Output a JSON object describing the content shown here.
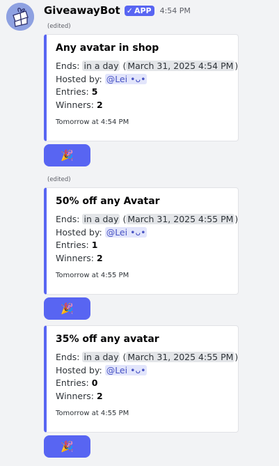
{
  "bot": {
    "name": "GiveawayBot",
    "badge": "APP",
    "badge_check": "✓",
    "time": "4:54 PM",
    "avatar_icon": "giveaway-bot-avatar-icon"
  },
  "messages": [
    {
      "edited": "(edited)",
      "title": "Any avatar in shop",
      "ends_label": "Ends:",
      "ends_relative": "in a day",
      "ends_absolute": "March 31, 2025 4:54 PM",
      "hosted_label": "Hosted by:",
      "host": "@Lei •ᴗ•",
      "entries_label": "Entries:",
      "entries": "5",
      "winners_label": "Winners:",
      "winners": "2",
      "footer": "Tomorrow at 4:54 PM",
      "button_emoji": "🎉"
    },
    {
      "edited": "(edited)",
      "title": "50% off any Avatar",
      "ends_label": "Ends:",
      "ends_relative": "in a day",
      "ends_absolute": "March 31, 2025 4:55 PM",
      "hosted_label": "Hosted by:",
      "host": "@Lei •ᴗ•",
      "entries_label": "Entries:",
      "entries": "1",
      "winners_label": "Winners:",
      "winners": "2",
      "footer": "Tomorrow at 4:55 PM",
      "button_emoji": "🎉"
    },
    {
      "title": "35% off any avatar",
      "ends_label": "Ends:",
      "ends_relative": "in a day",
      "ends_absolute": "March 31, 2025 4:55 PM",
      "hosted_label": "Hosted by:",
      "host": "@Lei •ᴗ•",
      "entries_label": "Entries:",
      "entries": "0",
      "winners_label": "Winners:",
      "winners": "2",
      "footer": "Tomorrow at 4:55 PM",
      "button_emoji": "🎉"
    }
  ],
  "colors": {
    "accent": "#5865f2",
    "background": "#f2f3f5",
    "embed_background": "#ffffff",
    "mention_background": "#e2e5fb",
    "mention_text": "#4752c4"
  }
}
